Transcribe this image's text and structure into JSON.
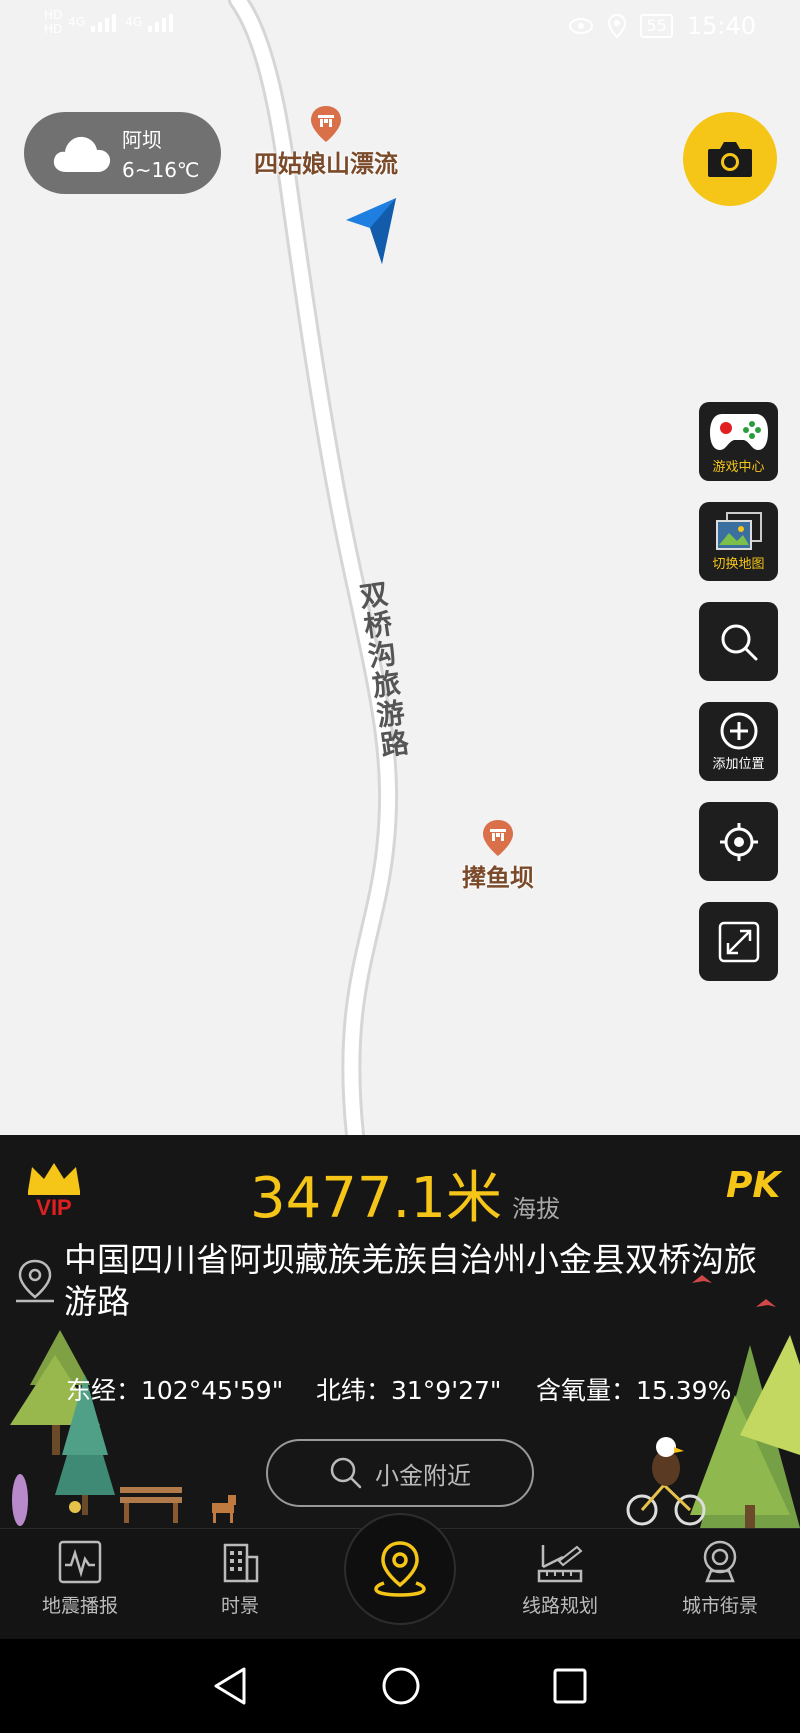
{
  "status_bar": {
    "network_left": [
      "HD",
      "4G",
      "HD",
      "4G"
    ],
    "battery": "55",
    "time": "15:40"
  },
  "map": {
    "road_name": "双桥沟旅游路",
    "pois": [
      {
        "name": "四姑娘山漂流"
      },
      {
        "name": "撵鱼坝"
      }
    ]
  },
  "weather": {
    "city": "阿坝",
    "temperature": "6~16℃"
  },
  "side_buttons": {
    "game_center": "游戏中心",
    "switch_map": "切换地图",
    "add_location": "添加位置"
  },
  "panel": {
    "vip_label": "VIP",
    "altitude_value": "3477.1",
    "altitude_unit": "米",
    "altitude_label": "海拔",
    "pk_label": "PK",
    "address": "中国四川省阿坝藏族羌族自治州小金县双桥沟旅游路",
    "longitude": "东经：102°45'59\"",
    "latitude": "北纬：31°9'27\"",
    "oxygen": "含氧量：15.39%",
    "nearby_button": "小金附近"
  },
  "tabs": [
    {
      "label": "地震播报",
      "icon": "seismograph-icon"
    },
    {
      "label": "时景",
      "icon": "building-icon"
    },
    {
      "label": "",
      "icon": "location-pin-icon"
    },
    {
      "label": "线路规划",
      "icon": "route-ruler-icon"
    },
    {
      "label": "城市街景",
      "icon": "street-view-camera-icon"
    }
  ],
  "colors": {
    "accent": "#f5c518",
    "panel_bg": "#161616",
    "map_bg": "#f2f2f2",
    "poi_text": "#7a4a2a"
  }
}
